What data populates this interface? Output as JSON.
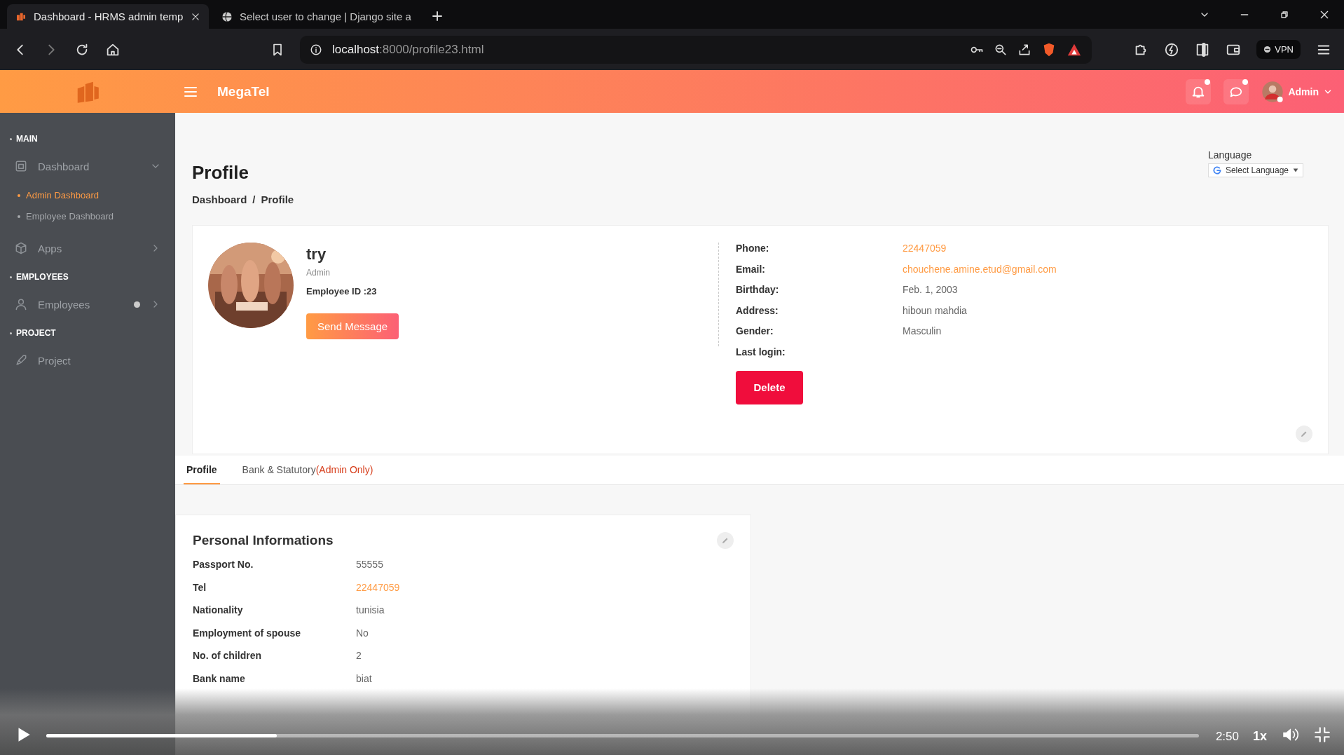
{
  "browser": {
    "tabs": [
      {
        "title": "Dashboard - HRMS admin temp",
        "selected": true,
        "kind": "app"
      },
      {
        "title": "Select user to change | Django site a",
        "selected": false,
        "kind": "globe"
      }
    ],
    "address": {
      "host": "localhost",
      "path": ":8000/profile23.html"
    },
    "vpn": "VPN"
  },
  "header": {
    "brand": "MegaTel",
    "user": "Admin"
  },
  "sidebar": {
    "sections": [
      {
        "title": "MAIN",
        "items": [
          {
            "label": "Dashboard",
            "expanded": true,
            "children": [
              {
                "label": "Admin Dashboard",
                "selected": true
              },
              {
                "label": "Employee Dashboard",
                "selected": false
              }
            ]
          },
          {
            "label": "Apps",
            "expanded": false
          }
        ]
      },
      {
        "title": "EMPLOYEES",
        "items": [
          {
            "label": "Employees",
            "expanded": false,
            "dot": true
          }
        ]
      },
      {
        "title": "PROJECT",
        "items": [
          {
            "label": "Project"
          }
        ]
      }
    ]
  },
  "page": {
    "title": "Profile",
    "breadcrumb": [
      "Dashboard",
      "Profile"
    ],
    "separator": "/",
    "language": {
      "label": "Language",
      "select": "Select Language"
    }
  },
  "profile": {
    "name": "try",
    "role": "Admin",
    "employee_id": "Employee ID :23",
    "send_button": "Send Message",
    "fields": [
      {
        "label": "Phone:",
        "value": "22447059",
        "link": true
      },
      {
        "label": "Email:",
        "value": "chouchene.amine.etud@gmail.com",
        "link": true
      },
      {
        "label": "Birthday:",
        "value": "Feb. 1, 2003",
        "link": false
      },
      {
        "label": "Address:",
        "value": "hiboun mahdia",
        "link": false
      },
      {
        "label": "Gender:",
        "value": "Masculin",
        "link": false
      },
      {
        "label": "Last login:"
      }
    ],
    "delete_button": "Delete"
  },
  "tabs": [
    {
      "label": "Profile",
      "selected": true
    },
    {
      "label": "Bank & Statutory",
      "note": "(Admin Only)",
      "selected": false
    }
  ],
  "personal": {
    "title": "Personal Informations",
    "rows": [
      {
        "label": "Passport No.",
        "value": "55555",
        "link": false
      },
      {
        "label": "Tel",
        "value": "22447059",
        "link": true
      },
      {
        "label": "Nationality",
        "value": "tunisia",
        "link": false
      },
      {
        "label": "Employment of spouse",
        "value": "No",
        "link": false
      },
      {
        "label": "No. of children",
        "value": "2",
        "link": false
      },
      {
        "label": "Bank name",
        "value": "biat",
        "link": false
      }
    ]
  },
  "player": {
    "time": "2:50",
    "speed": "1x",
    "level": 0.2
  }
}
